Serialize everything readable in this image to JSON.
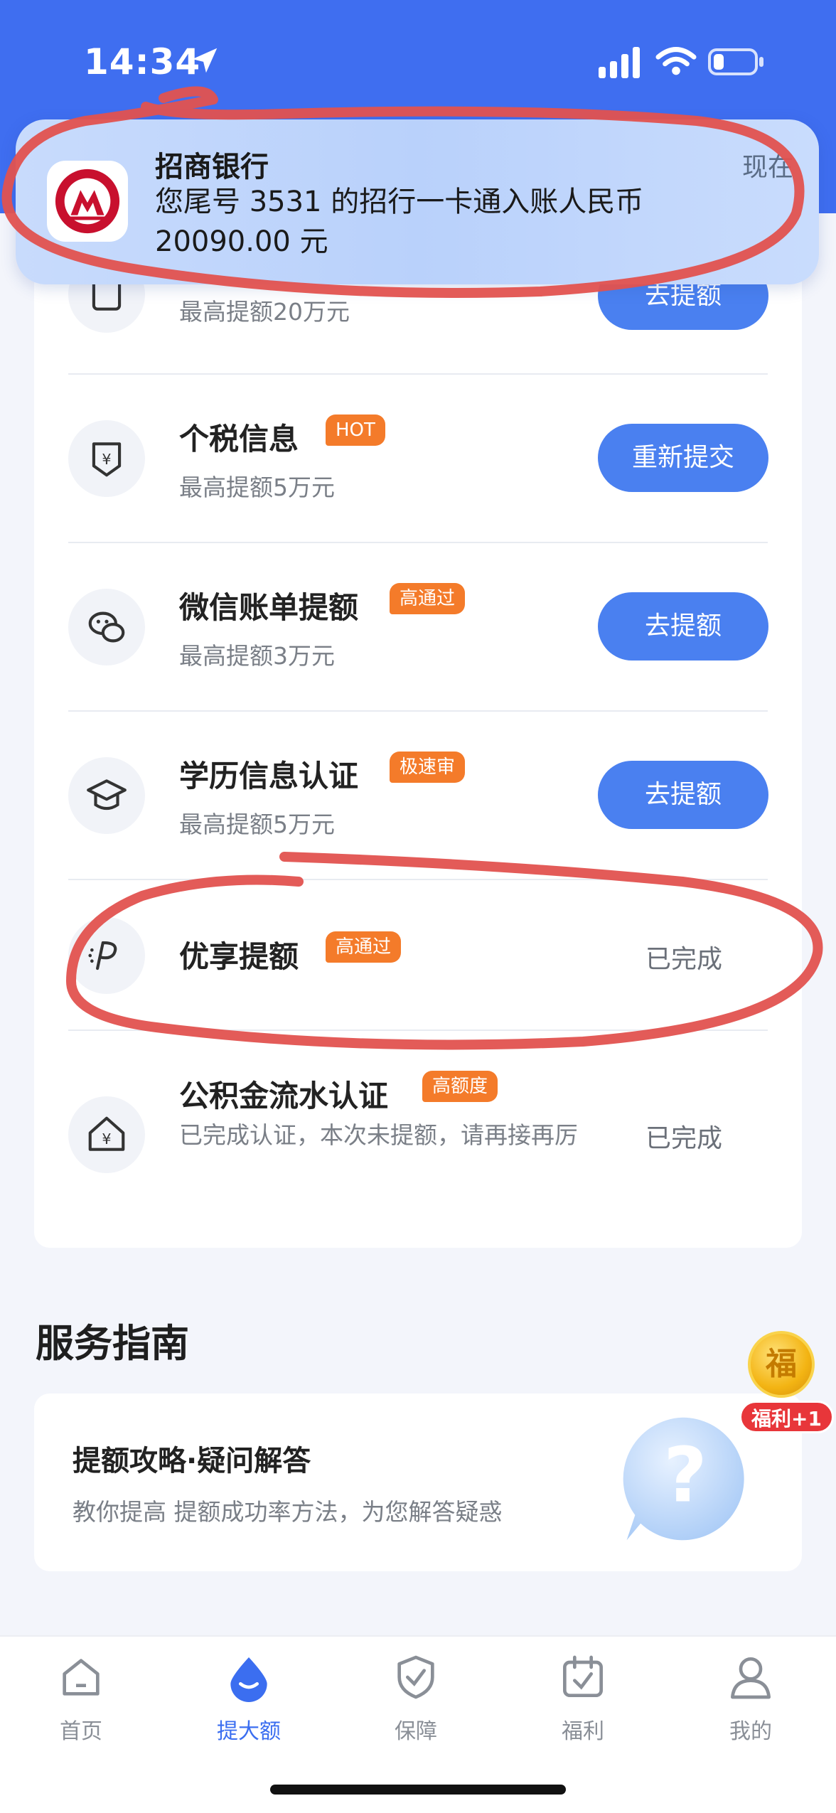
{
  "status_bar": {
    "time": "14:34"
  },
  "notification": {
    "app_name": "招商银行",
    "time": "现在",
    "message": "您尾号 3531 的招行一卡通入账人民币 20090.00 元"
  },
  "items": [
    {
      "title": "",
      "subtitle": "最高提额20万元",
      "tag": "",
      "action": "去提额"
    },
    {
      "title": "个税信息",
      "tag": "HOT",
      "subtitle": "最高提额5万元",
      "action": "重新提交"
    },
    {
      "title": "微信账单提额",
      "tag": "高通过",
      "subtitle": "最高提额3万元",
      "action": "去提额"
    },
    {
      "title": "学历信息认证",
      "tag": "极速审",
      "subtitle": "最高提额5万元",
      "action": "去提额"
    },
    {
      "title": "优享提额",
      "tag": "高通过",
      "subtitle": "",
      "action": "已完成"
    },
    {
      "title": "公积金流水认证",
      "tag": "高额度",
      "subtitle": "已完成认证，本次未提额，请再接再厉",
      "action": "已完成"
    }
  ],
  "guide": {
    "heading": "服务指南",
    "card_title": "提额攻略·疑问解答",
    "card_subtitle": "教你提高 提额成功率方法，为您解答疑惑"
  },
  "floating": {
    "coin_char": "福",
    "badge": "福利+1"
  },
  "tabbar": [
    {
      "label": "首页",
      "icon": "home-icon",
      "active": false
    },
    {
      "label": "提大额",
      "icon": "drop-icon",
      "active": true
    },
    {
      "label": "保障",
      "icon": "shield-check-icon",
      "active": false
    },
    {
      "label": "福利",
      "icon": "calendar-check-icon",
      "active": false
    },
    {
      "label": "我的",
      "icon": "user-icon",
      "active": false
    }
  ],
  "colors": {
    "brand": "#3f6ef0",
    "button": "#4a80f0",
    "tag": "#f47b2a",
    "annotation": "#e2524f"
  }
}
